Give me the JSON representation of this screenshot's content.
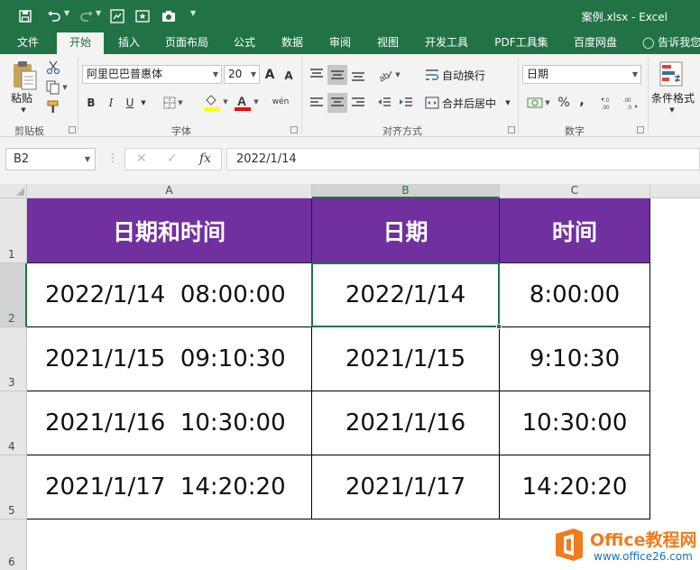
{
  "window": {
    "title": "案例.xlsx  -  Excel"
  },
  "tabs": [
    "文件",
    "开始",
    "插入",
    "页面布局",
    "公式",
    "数据",
    "审阅",
    "视图",
    "开发工具",
    "PDF工具集",
    "百度网盘"
  ],
  "active_tab": "开始",
  "tell_me": "告诉我您",
  "ribbon": {
    "groups": {
      "clipboard": "剪贴板",
      "font": "字体",
      "alignment": "对齐方式",
      "number": "数字"
    },
    "paste_label": "粘贴",
    "font_name": "阿里巴巴普惠体",
    "font_size": "20",
    "grow_font": "A",
    "shrink_font": "A",
    "bold": "B",
    "italic": "I",
    "underline": "U",
    "phonetic": "wén",
    "wrap_text": "自动换行",
    "merge_center": "合并后居中",
    "number_format": "日期",
    "percent": "%",
    "comma": ",",
    "cond_format": "条件格式"
  },
  "formula_bar": {
    "name_box": "B2",
    "fx": "fx",
    "value": "2022/1/14"
  },
  "grid": {
    "columns": [
      "A",
      "B",
      "C"
    ],
    "rows": [
      "1",
      "2",
      "3",
      "4",
      "5",
      "6"
    ],
    "headers": [
      "日期和时间",
      "日期",
      "时间"
    ],
    "data": [
      [
        "2022/1/14  08:00:00",
        "2022/1/14",
        "8:00:00"
      ],
      [
        "2021/1/15  09:10:30",
        "2021/1/15",
        "9:10:30"
      ],
      [
        "2021/1/16  10:30:00",
        "2021/1/16",
        "10:30:00"
      ],
      [
        "2021/1/17  14:20:20",
        "2021/1/17",
        "14:20:20"
      ]
    ],
    "selected_cell": "B2"
  },
  "colors": {
    "excel_green": "#217346",
    "header_purple": "#7030a0"
  },
  "watermark": {
    "brand": "Office教程网",
    "url": "www.office26.com"
  }
}
